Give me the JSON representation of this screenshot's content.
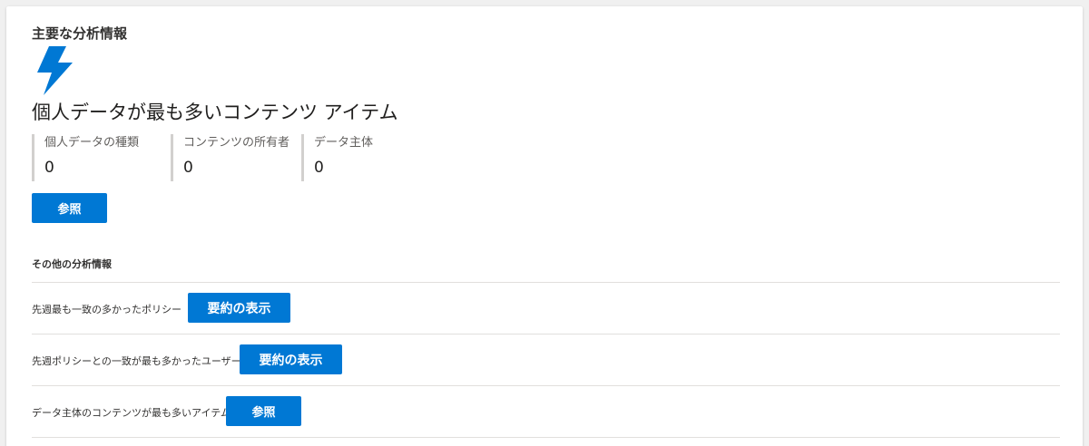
{
  "top_insight": {
    "title": "主要な分析情報",
    "icon": "lightning-bolt-icon",
    "headline": "個人データが最も多いコンテンツ アイテム",
    "metrics": [
      {
        "label": "個人データの種類",
        "value": "0"
      },
      {
        "label": "コンテンツの所有者",
        "value": "0"
      },
      {
        "label": "データ主体",
        "value": "0"
      }
    ],
    "browse_button": "参照"
  },
  "other_insights": {
    "title": "その他の分析情報",
    "rows": [
      {
        "label": "先週最も一致の多かったポリシー",
        "button": "要約の表示"
      },
      {
        "label": "先週ポリシーとの一致が最も多かったユーザー",
        "button": "要約の表示"
      },
      {
        "label": "データ主体のコンテンツが最も多いアイテム",
        "button": "参照"
      }
    ]
  },
  "colors": {
    "accent": "#0078d4",
    "card_background": "#ffffff",
    "page_background": "#f0f0f0",
    "divider": "#e1dfdd",
    "metric_bar": "#d2d0ce"
  }
}
